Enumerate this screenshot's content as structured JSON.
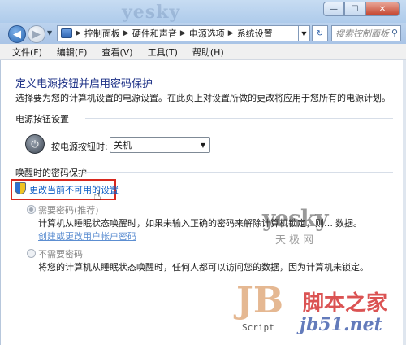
{
  "window": {
    "watermark": "yesky",
    "minimize_glyph": "—",
    "maximize_glyph": "☐",
    "close_glyph": "✕"
  },
  "address_bar": {
    "crumbs": [
      "控制面板",
      "硬件和声音",
      "电源选项",
      "系统设置"
    ],
    "search_placeholder": "搜索控制面板"
  },
  "menu": [
    "文件(F)",
    "编辑(E)",
    "查看(V)",
    "工具(T)",
    "帮助(H)"
  ],
  "page": {
    "title": "定义电源按钮并启用密码保护",
    "description": "选择要为您的计算机设置的电源设置。在此页上对设置所做的更改将应用于您所有的电源计划。"
  },
  "power_section": {
    "title": "电源按钮设置",
    "button_label": "按电源按钮时:",
    "selected_option": "关机"
  },
  "wake_section": {
    "title": "唤醒时的密码保护",
    "change_link": "更改当前不可用的设置",
    "option_require": {
      "label": "需要密码(推荐)",
      "desc": "计算机从睡眠状态唤醒时，如果未输入正确的密码来解除计算机锁定，则…",
      "desc_tail": "数据。",
      "link": "创建或更改用户帐户密码",
      "checked": true
    },
    "option_none": {
      "label": "不需要密码",
      "desc": "将您的计算机从睡眠状态唤醒时，任何人都可以访问您的数据，因为计算机未锁定。",
      "checked": false
    }
  },
  "watermarks": {
    "yesky": "yesky",
    "tianji": "天极网",
    "jb": "JB",
    "script": "Script",
    "site_cn": "脚本之家",
    "site": "jb51.net"
  }
}
